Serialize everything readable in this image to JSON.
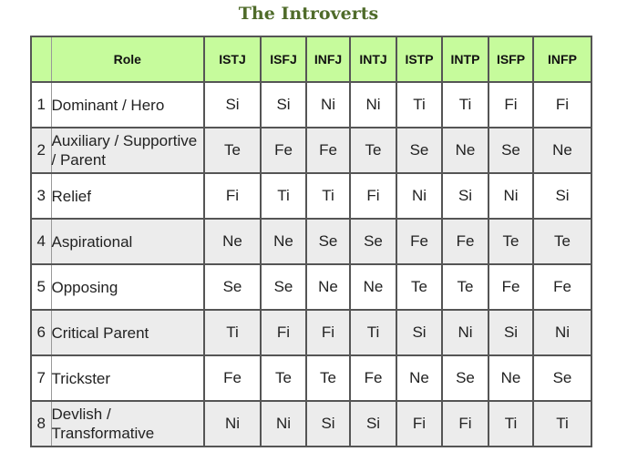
{
  "title": "The Introverts",
  "table": {
    "role_header": "Role",
    "types": [
      "ISTJ",
      "ISFJ",
      "INFJ",
      "INTJ",
      "ISTP",
      "INTP",
      "ISFP",
      "INFP"
    ],
    "rows": [
      {
        "num": "1",
        "role": "Dominant / Hero",
        "values": [
          "Si",
          "Si",
          "Ni",
          "Ni",
          "Ti",
          "Ti",
          "Fi",
          "Fi"
        ]
      },
      {
        "num": "2",
        "role": "Auxiliary / Supportive / Parent",
        "values": [
          "Te",
          "Fe",
          "Fe",
          "Te",
          "Se",
          "Ne",
          "Se",
          "Ne"
        ]
      },
      {
        "num": "3",
        "role": "Relief",
        "values": [
          "Fi",
          "Ti",
          "Ti",
          "Fi",
          "Ni",
          "Si",
          "Ni",
          "Si"
        ]
      },
      {
        "num": "4",
        "role": "Aspirational",
        "values": [
          "Ne",
          "Ne",
          "Se",
          "Se",
          "Fe",
          "Fe",
          "Te",
          "Te"
        ]
      },
      {
        "num": "5",
        "role": "Opposing",
        "values": [
          "Se",
          "Se",
          "Ne",
          "Ne",
          "Te",
          "Te",
          "Fe",
          "Fe"
        ]
      },
      {
        "num": "6",
        "role": "Critical Parent",
        "values": [
          "Ti",
          "Fi",
          "Fi",
          "Ti",
          "Si",
          "Ni",
          "Si",
          "Ni"
        ]
      },
      {
        "num": "7",
        "role": "Trickster",
        "values": [
          "Fe",
          "Te",
          "Te",
          "Fe",
          "Ne",
          "Se",
          "Ne",
          "Se"
        ]
      },
      {
        "num": "8",
        "role": "Devlish / Transformative",
        "values": [
          "Ni",
          "Ni",
          "Si",
          "Si",
          "Fi",
          "Fi",
          "Ti",
          "Ti"
        ]
      }
    ]
  },
  "colors": {
    "header_bg": "#c6fb9c",
    "title_color": "#4f6b2a",
    "alt_row_bg": "#ececec"
  }
}
